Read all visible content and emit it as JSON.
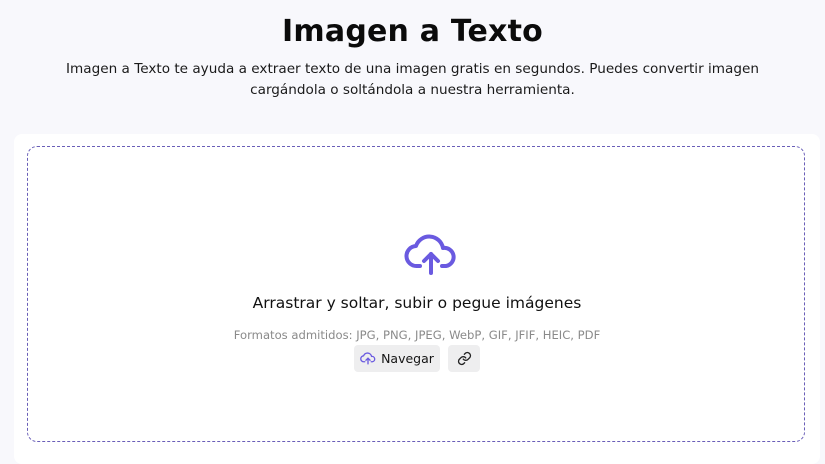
{
  "header": {
    "title": "Imagen a Texto",
    "subtitle": "Imagen a Texto te ayuda a extraer texto de una imagen gratis en segundos. Puedes convertir imagen cargándola o soltándola a nuestra herramienta."
  },
  "dropzone": {
    "icon": "cloud-upload-icon",
    "title": "Arrastrar y soltar, subir o pegue imágenes",
    "formats": "Formatos admitidos: JPG, PNG, JPEG, WebP, GIF, JFIF, HEIC, PDF",
    "browse_label": "Navegar",
    "browse_icon": "cloud-upload-icon",
    "link_icon": "link-icon"
  },
  "colors": {
    "accent": "#6a5ae0",
    "dashed_border": "#6a5fb8",
    "button_bg": "#eeeeef",
    "page_bg": "#f8f8fc"
  }
}
